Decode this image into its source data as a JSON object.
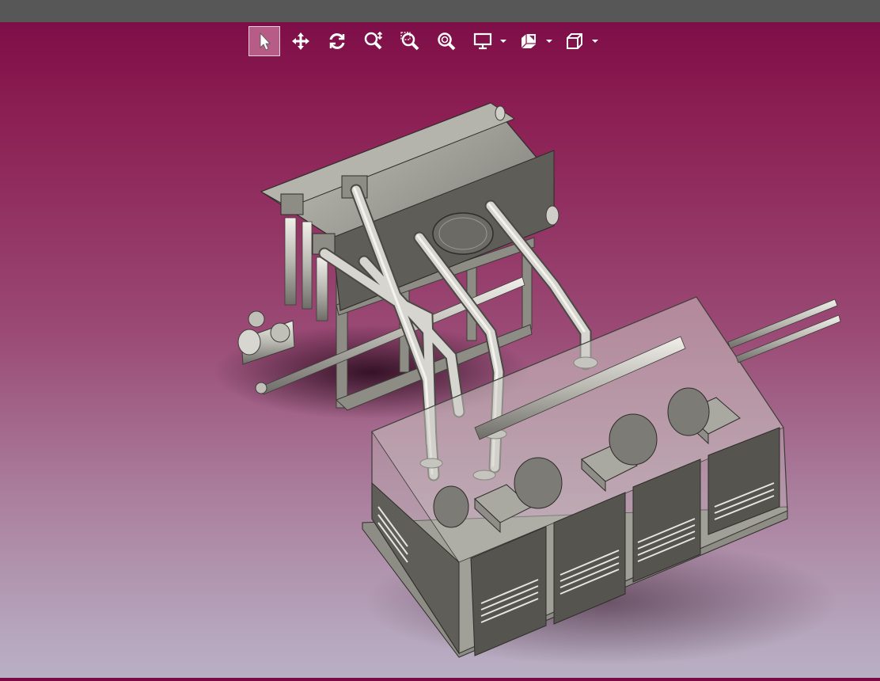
{
  "window": {
    "titlebar_color": "#575757"
  },
  "viewport": {
    "background_top": "#7a0a45",
    "background_bottom": "#b9b0c4"
  },
  "toolbar": {
    "items": [
      {
        "icon": "select-arrow-icon",
        "active": true
      },
      {
        "icon": "pan-move-icon"
      },
      {
        "icon": "rotate-icon"
      },
      {
        "icon": "zoom-in-out-icon"
      },
      {
        "icon": "zoom-area-icon"
      },
      {
        "icon": "zoom-fit-icon"
      },
      {
        "icon": "display-monitor-icon",
        "dropdown": true
      },
      {
        "icon": "section-view-icon",
        "dropdown": true
      },
      {
        "icon": "view-cube-icon",
        "dropdown": true
      }
    ]
  },
  "model": {
    "description_icon": "3d-assembly-model"
  }
}
